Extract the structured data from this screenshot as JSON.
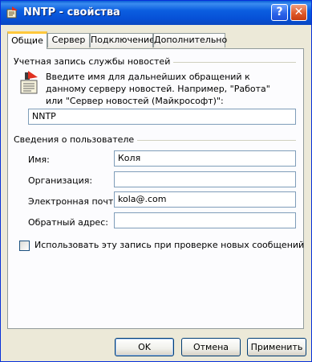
{
  "window": {
    "title": "NNTP - свойства"
  },
  "titlebar": {
    "help_glyph": "?",
    "close_glyph": "✕"
  },
  "tabs": [
    {
      "label": "Общие",
      "active": true
    },
    {
      "label": "Сервер",
      "active": false
    },
    {
      "label": "Подключение",
      "active": false
    },
    {
      "label": "Дополнительно",
      "active": false
    }
  ],
  "account_group": {
    "title": "Учетная запись службы новостей",
    "description": "Введите имя для дальнейших обращений к данному серверу новостей. Например, \"Работа\" или \"Сервер новостей (Майкрософт)\":",
    "account_name": "NNTP"
  },
  "user_group": {
    "title": "Сведения о пользователе",
    "fields": [
      {
        "label": "Имя:",
        "value": "Коля"
      },
      {
        "label": "Организация:",
        "value": ""
      },
      {
        "label": "Электронная почта:",
        "value": "kola@.com"
      },
      {
        "label": "Обратный адрес:",
        "value": ""
      }
    ]
  },
  "check_new_messages": {
    "label": "Использовать эту запись при проверке новых сообщений",
    "checked": false
  },
  "buttons": {
    "ok": "OK",
    "cancel": "Отмена",
    "apply": "Применить"
  },
  "colors": {
    "titlebar": "#0a5fd6",
    "tab_highlight": "#ffc83c",
    "panel": "#fcfcfe",
    "dialog": "#ece9d8"
  }
}
